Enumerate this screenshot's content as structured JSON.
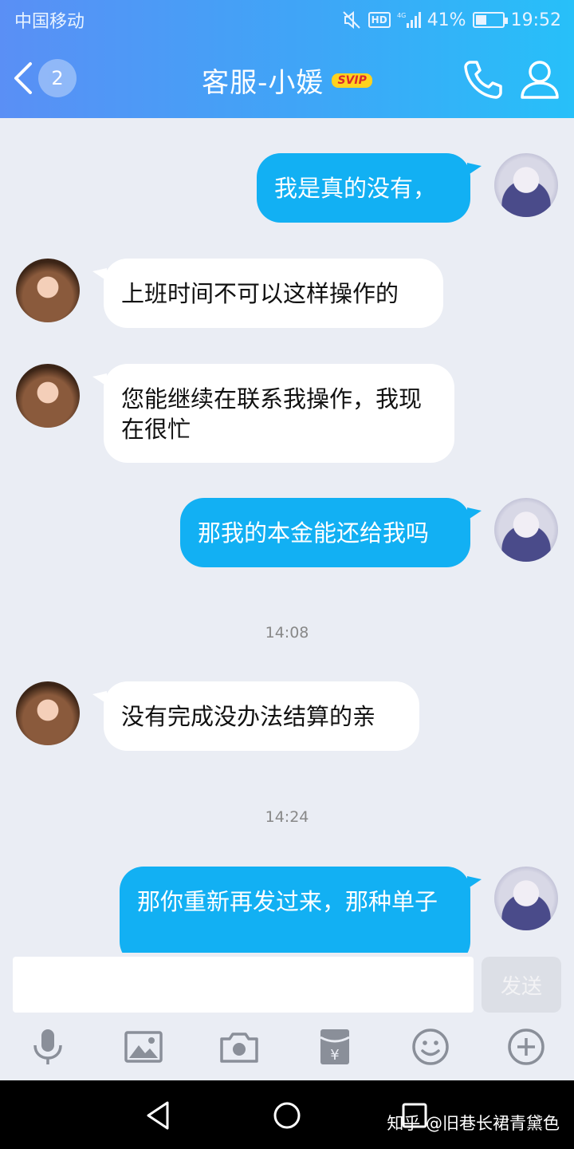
{
  "status_bar": {
    "carrier": "中国移动",
    "hd": "HD",
    "network": "4G",
    "battery_percent": "41%",
    "battery_level": 0.41,
    "time": "19:52"
  },
  "header": {
    "unread_count": "2",
    "title": "客服-小媛",
    "badge": "SVIP"
  },
  "messages": [
    {
      "side": "out",
      "text": "我是真的没有，"
    },
    {
      "side": "in",
      "text": "上班时间不可以这样操作的"
    },
    {
      "side": "in",
      "text": "您能继续在联系我操作，我现在很忙"
    },
    {
      "side": "out",
      "text": "那我的本金能还给我吗"
    },
    {
      "side": "time",
      "text": "14:08"
    },
    {
      "side": "in",
      "text": "没有完成没办法结算的亲"
    },
    {
      "side": "time",
      "text": "14:24"
    },
    {
      "side": "out",
      "text": "那你重新再发过来，那种单子"
    }
  ],
  "composer": {
    "input_value": "",
    "send_label": "发送"
  },
  "toolbar_icons": [
    "microphone-icon",
    "image-icon",
    "camera-icon",
    "red-packet-icon",
    "emoji-icon",
    "plus-icon"
  ],
  "watermark": "知乎 @旧巷长裙青黛色",
  "colors": {
    "header_start": "#5a8ff5",
    "header_end": "#27c0f9",
    "outgoing_bubble": "#12b0f3",
    "incoming_bubble": "#ffffff",
    "background": "#eaedf4"
  }
}
